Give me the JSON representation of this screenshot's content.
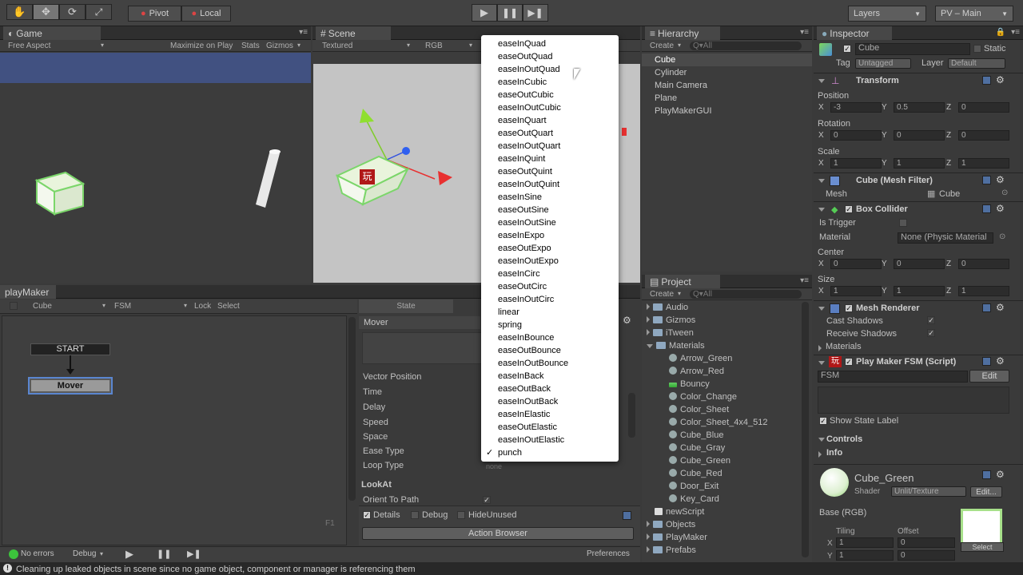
{
  "toolbar": {
    "pivot": "Pivot",
    "local": "Local",
    "layers": "Layers",
    "layout": "PV – Main"
  },
  "game": {
    "tab": "Game",
    "aspect": "Free Aspect",
    "maximize": "Maximize on Play",
    "stats": "Stats",
    "gizmos": "Gizmos"
  },
  "scene": {
    "tab": "Scene",
    "mode": "Textured",
    "rgb": "RGB",
    "badge": "玩"
  },
  "hierarchy": {
    "tab": "Hierarchy",
    "create": "Create",
    "search": "Q▾All",
    "items": [
      "Cube",
      "Cylinder",
      "Main Camera",
      "Plane",
      "PlayMakerGUI"
    ]
  },
  "project": {
    "tab": "Project",
    "create": "Create",
    "search": "Q▾All",
    "items": [
      {
        "label": "Audio",
        "kind": "folder",
        "exp": "r"
      },
      {
        "label": "Gizmos",
        "kind": "folder",
        "exp": "r"
      },
      {
        "label": "iTween",
        "kind": "folder",
        "exp": "r"
      },
      {
        "label": "Materials",
        "kind": "folder",
        "exp": "d"
      },
      {
        "label": "Arrow_Green",
        "kind": "mat",
        "exp": ""
      },
      {
        "label": "Arrow_Red",
        "kind": "mat",
        "exp": ""
      },
      {
        "label": "Bouncy",
        "kind": "phys",
        "exp": ""
      },
      {
        "label": "Color_Change",
        "kind": "mat",
        "exp": ""
      },
      {
        "label": "Color_Sheet",
        "kind": "mat",
        "exp": ""
      },
      {
        "label": "Color_Sheet_4x4_512",
        "kind": "mat",
        "exp": ""
      },
      {
        "label": "Cube_Blue",
        "kind": "mat",
        "exp": ""
      },
      {
        "label": "Cube_Gray",
        "kind": "mat",
        "exp": ""
      },
      {
        "label": "Cube_Green",
        "kind": "mat",
        "exp": ""
      },
      {
        "label": "Cube_Red",
        "kind": "mat",
        "exp": ""
      },
      {
        "label": "Door_Exit",
        "kind": "mat",
        "exp": ""
      },
      {
        "label": "Key_Card",
        "kind": "mat",
        "exp": ""
      },
      {
        "label": "newScript",
        "kind": "script",
        "exp": ""
      },
      {
        "label": "Objects",
        "kind": "folder",
        "exp": "r"
      },
      {
        "label": "PlayMaker",
        "kind": "folder",
        "exp": "r"
      },
      {
        "label": "Prefabs",
        "kind": "folder",
        "exp": "r"
      }
    ]
  },
  "inspector": {
    "tab": "Inspector",
    "name": "Cube",
    "static": "Static",
    "tag_label": "Tag",
    "tag": "Untagged",
    "layer_label": "Layer",
    "layer": "Default",
    "transform": "Transform",
    "position": "Position",
    "rotation": "Rotation",
    "scale": "Scale",
    "x": "X",
    "y": "Y",
    "z": "Z",
    "pos": [
      "-3",
      "0.5",
      "0"
    ],
    "rot": [
      "0",
      "0",
      "0"
    ],
    "scl": [
      "1",
      "1",
      "1"
    ],
    "meshfilter": "Cube (Mesh Filter)",
    "mesh_label": "Mesh",
    "mesh": "Cube",
    "boxcollider": "Box Collider",
    "istrigger": "Is Trigger",
    "material_label": "Material",
    "material": "None (Physic Material",
    "center": "Center",
    "center_v": [
      "0",
      "0",
      "0"
    ],
    "size": "Size",
    "size_v": [
      "1",
      "1",
      "1"
    ],
    "meshrenderer": "Mesh Renderer",
    "castshadows": "Cast Shadows",
    "receiveshadows": "Receive Shadows",
    "materials": "Materials",
    "pmfsm": "Play Maker FSM (Script)",
    "fsm": "FSM",
    "edit": "Edit",
    "showstate": "Show State Label",
    "controls": "Controls",
    "info": "Info",
    "matname": "Cube_Green",
    "shader_label": "Shader",
    "shader": "Unlit/Texture",
    "edit2": "Edit...",
    "base": "Base (RGB)",
    "tiling": "Tiling",
    "offset": "Offset",
    "tx": "1",
    "ty": "1",
    "ox": "0",
    "oy": "0",
    "select": "Select"
  },
  "playmaker": {
    "tab": "playMaker",
    "object": "Cube",
    "fsm": "FSM",
    "lock": "Lock",
    "select": "Select",
    "start": "START",
    "state": "Mover",
    "f1": "F1",
    "state_tab": "State",
    "action": "Mover",
    "rows": [
      "Vector Position",
      "Time",
      "Delay",
      "Speed",
      "Space",
      "Ease Type",
      "Loop Type"
    ],
    "loop_value": "none",
    "lookat": "LookAt",
    "orient": "Orient To Path",
    "details": "Details",
    "debug": "Debug",
    "hideunused": "HideUnused",
    "actionbrowser": "Action Browser",
    "preferences": "Preferences"
  },
  "ease_menu": {
    "items": [
      "easeInQuad",
      "easeOutQuad",
      "easeInOutQuad",
      "easeInCubic",
      "easeOutCubic",
      "easeInOutCubic",
      "easeInQuart",
      "easeOutQuart",
      "easeInOutQuart",
      "easeInQuint",
      "easeOutQuint",
      "easeInOutQuint",
      "easeInSine",
      "easeOutSine",
      "easeInOutSine",
      "easeInExpo",
      "easeOutExpo",
      "easeInOutExpo",
      "easeInCirc",
      "easeOutCirc",
      "easeInOutCirc",
      "linear",
      "spring",
      "easeInBounce",
      "easeOutBounce",
      "easeInOutBounce",
      "easeInBack",
      "easeOutBack",
      "easeInOutBack",
      "easeInElastic",
      "easeOutElastic",
      "easeInOutElastic",
      "punch"
    ],
    "selected": "punch",
    "check": "✓"
  },
  "bottom": {
    "errors": "No errors",
    "debug": "Debug",
    "status": "Cleaning up leaked objects in scene since no game object, component or manager is referencing them"
  }
}
